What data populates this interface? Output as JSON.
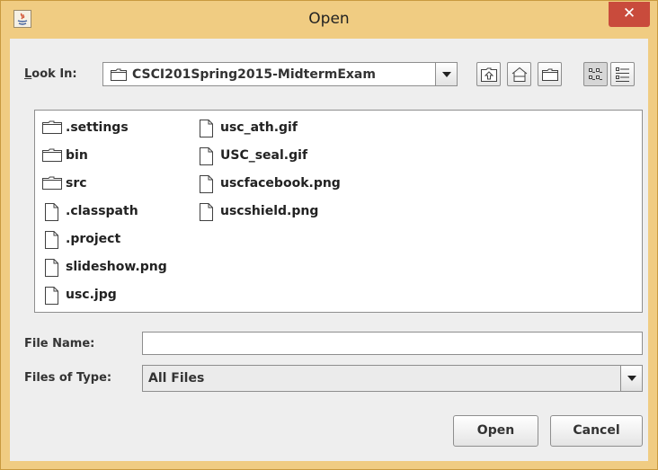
{
  "window": {
    "title": "Open",
    "close_symbol": "✕",
    "app_icon": "java-icon"
  },
  "look_in": {
    "label": "Look In:",
    "label_mnemonic": "L",
    "value": "CSCI201Spring2015-MidtermExam"
  },
  "toolbar": {
    "buttons": [
      "up-one-level-icon",
      "home-icon",
      "new-folder-icon",
      "list-view-icon",
      "details-view-icon"
    ],
    "selected_view": "list"
  },
  "files": [
    {
      "name": ".settings",
      "type": "folder"
    },
    {
      "name": "bin",
      "type": "folder"
    },
    {
      "name": "src",
      "type": "folder"
    },
    {
      "name": ".classpath",
      "type": "file"
    },
    {
      "name": ".project",
      "type": "file"
    },
    {
      "name": "slideshow.png",
      "type": "file"
    },
    {
      "name": "usc.jpg",
      "type": "file"
    },
    {
      "name": "usc_ath.gif",
      "type": "file"
    },
    {
      "name": "USC_seal.gif",
      "type": "file"
    },
    {
      "name": "uscfacebook.png",
      "type": "file"
    },
    {
      "name": "uscshield.png",
      "type": "file"
    }
  ],
  "file_name": {
    "label": "File Name:",
    "value": ""
  },
  "file_type": {
    "label": "Files of Type:",
    "value": "All Files"
  },
  "buttons": {
    "open": "Open",
    "cancel": "Cancel"
  },
  "colors": {
    "frame": "#f0cc82",
    "close_button": "#c94b3c",
    "panel": "#eeeeee"
  }
}
